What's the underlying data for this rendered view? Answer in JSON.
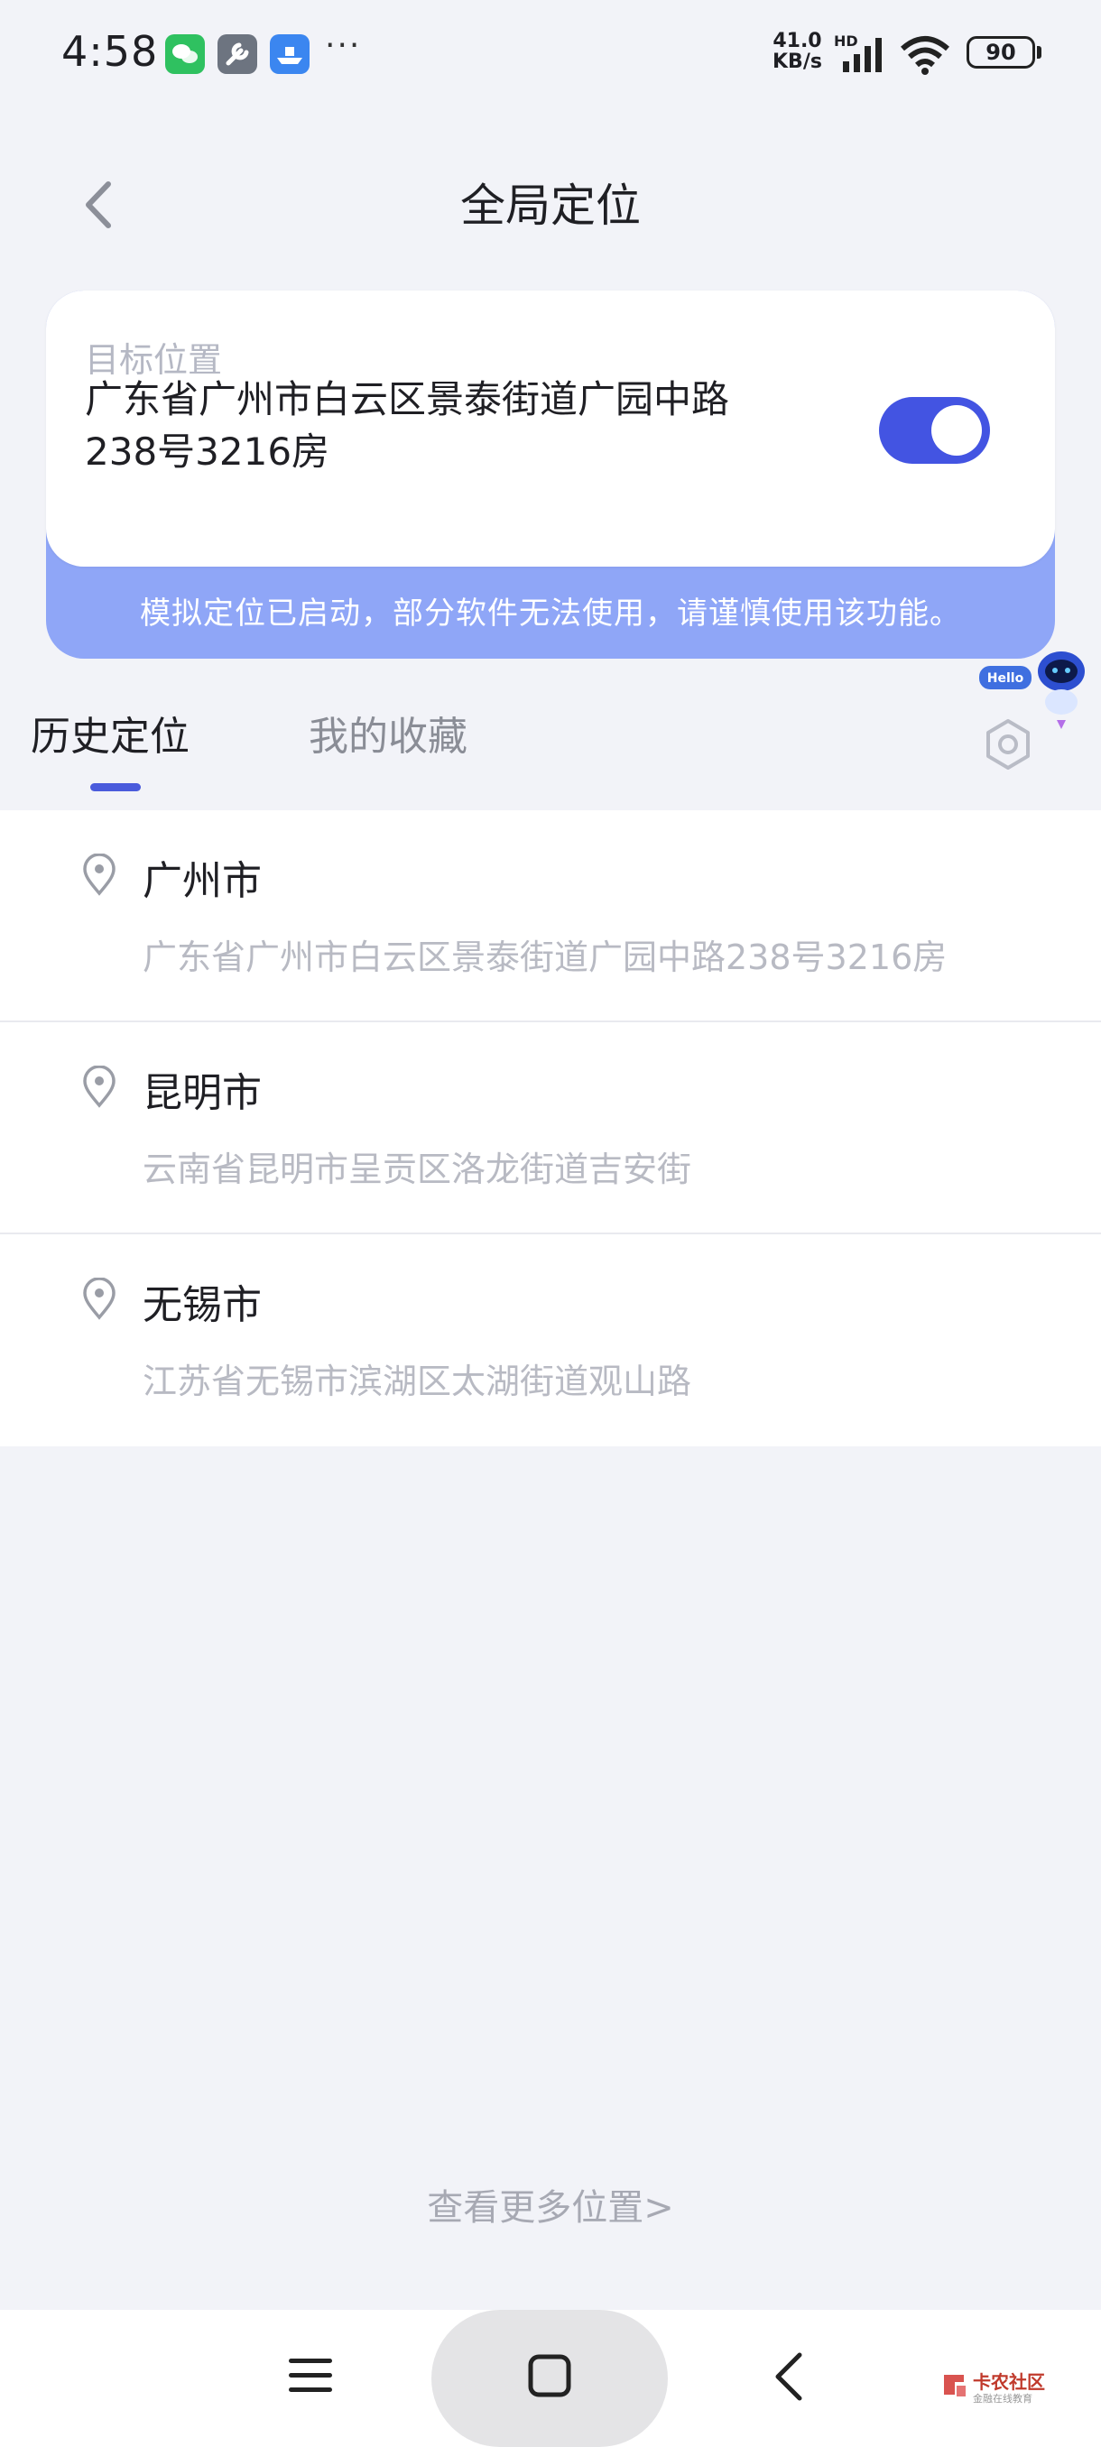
{
  "status_bar": {
    "time": "4:58",
    "more": "···",
    "net_speed_value": "41.0",
    "net_speed_unit": "KB/s",
    "hd": "HD",
    "battery": "90",
    "app_icons": [
      "wechat-icon",
      "wrench-icon",
      "boat-icon"
    ]
  },
  "header": {
    "title": "全局定位"
  },
  "target": {
    "label": "目标位置",
    "address": "广东省广州市白云区景泰街道广园中路238号3216房",
    "toggle_on": true,
    "notice": "模拟定位已启动，部分软件无法使用，请谨慎使用该功能。"
  },
  "tabs": [
    {
      "label": "历史定位",
      "active": true
    },
    {
      "label": "我的收藏",
      "active": false
    }
  ],
  "history": [
    {
      "city": "广州市",
      "address": "广东省广州市白云区景泰街道广园中路238号3216房"
    },
    {
      "city": "昆明市",
      "address": "云南省昆明市呈贡区洛龙街道吉安街"
    },
    {
      "city": "无锡市",
      "address": "江苏省无锡市滨湖区太湖街道观山路"
    }
  ],
  "more_link": "查看更多位置>",
  "mascot": {
    "bubble": "Hello"
  },
  "watermark": {
    "name": "卡农社区",
    "sub": "金融在线教育"
  },
  "colors": {
    "accent": "#4354e2",
    "notice_bg": "#8fa6f7",
    "page_bg": "#f2f3f8"
  }
}
